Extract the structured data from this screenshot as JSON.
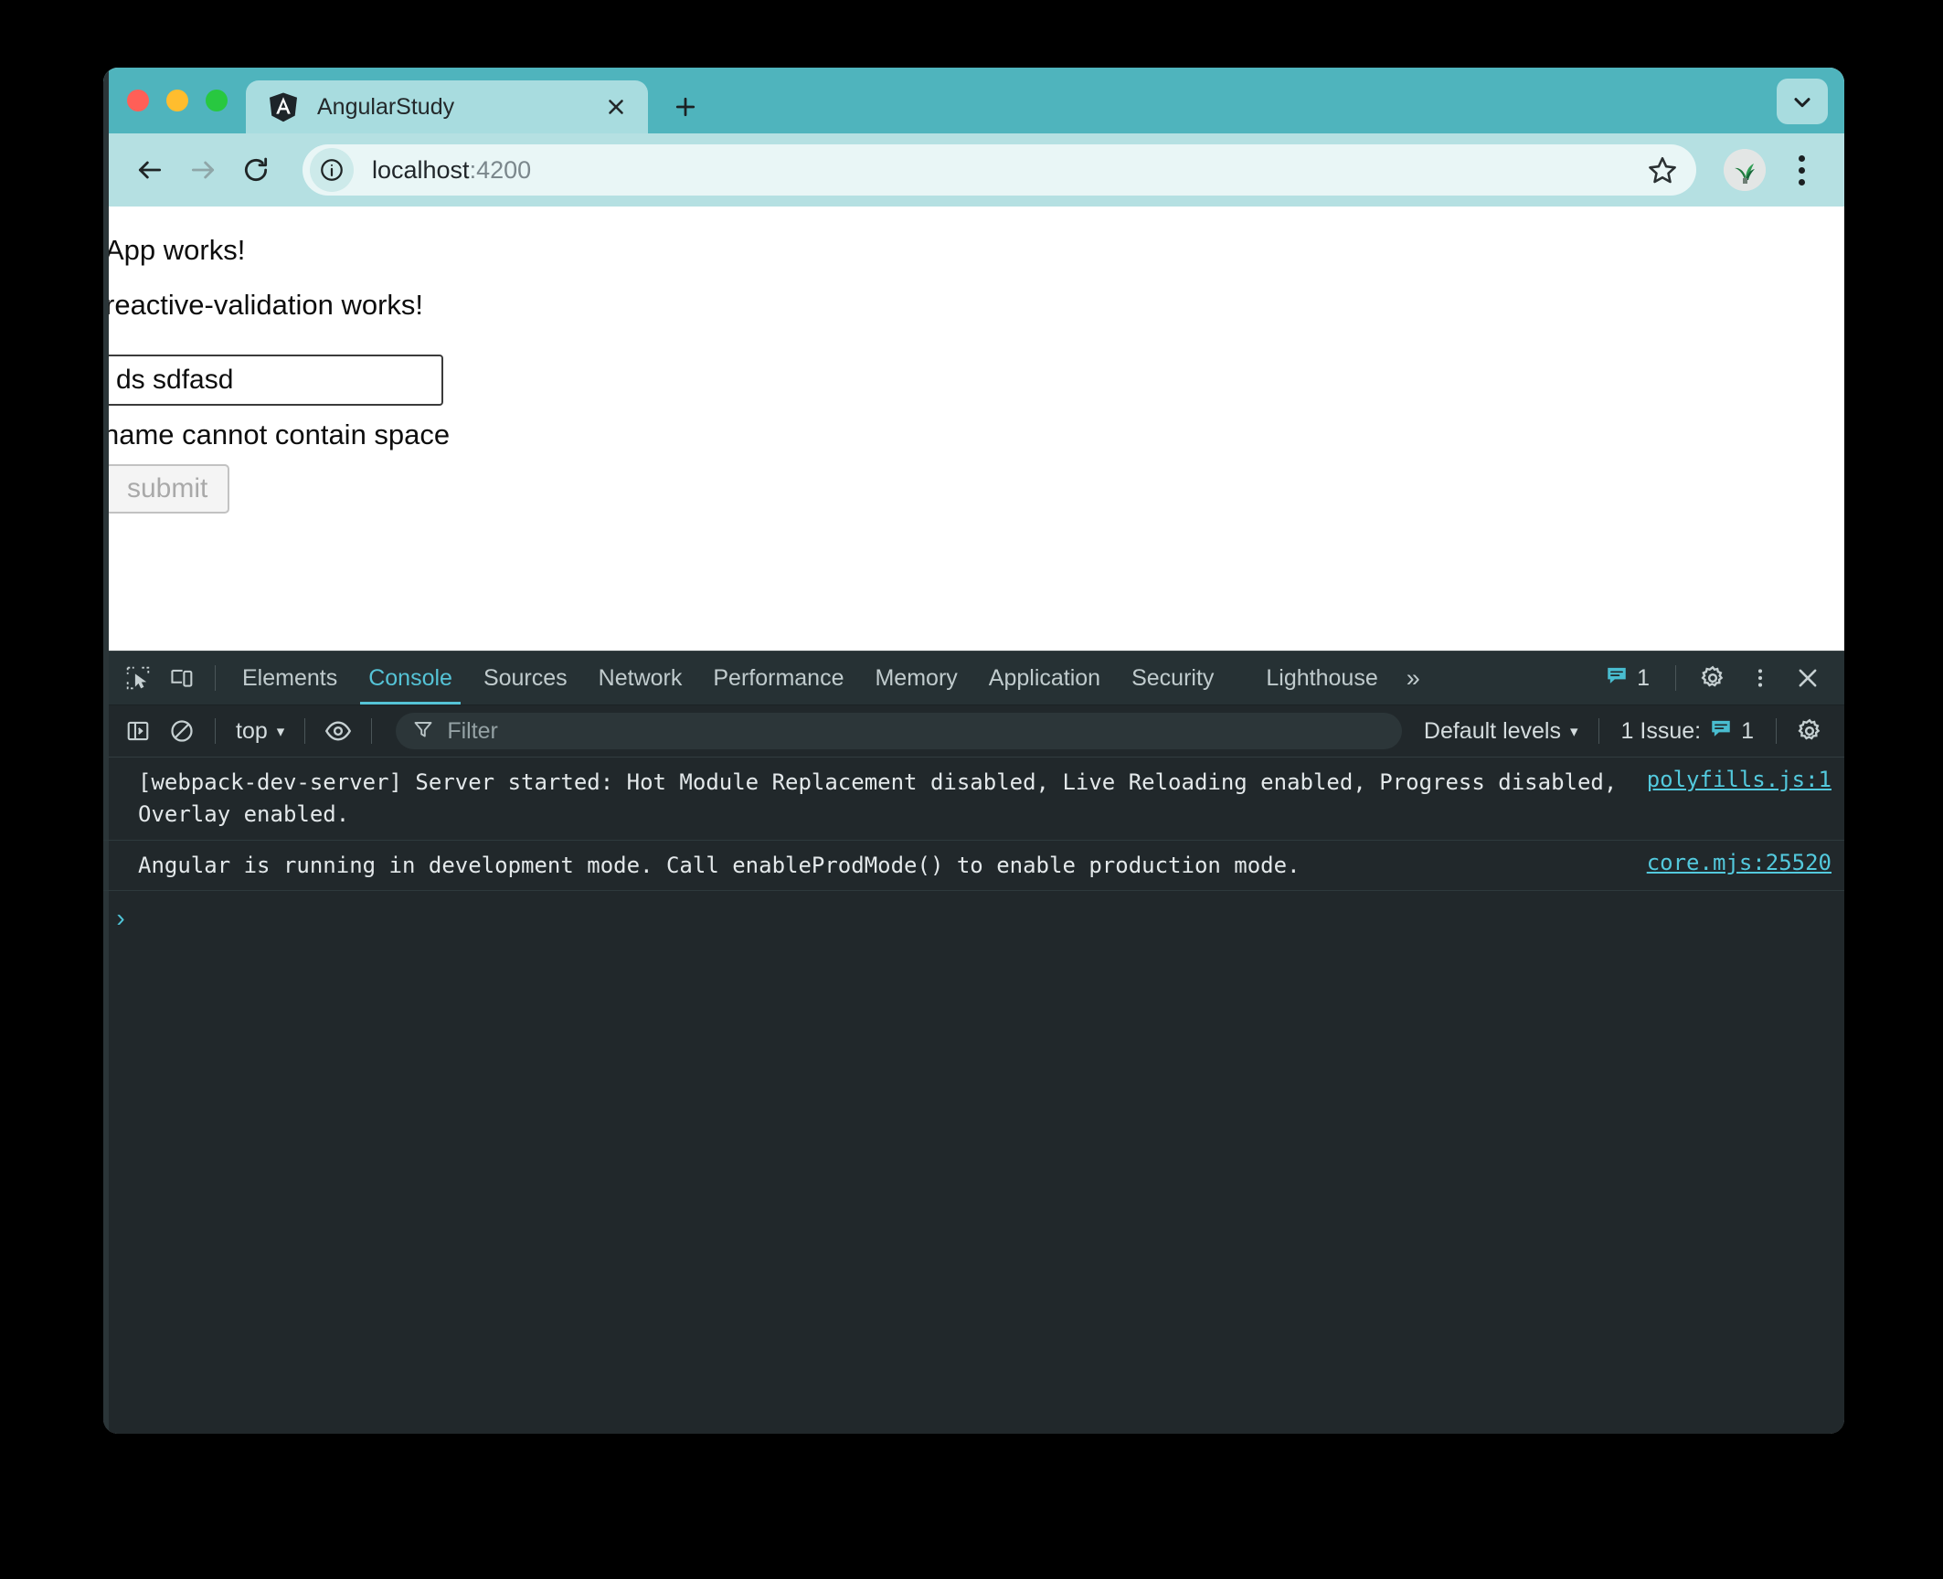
{
  "browser": {
    "window_controls": [
      "close",
      "minimize",
      "maximize"
    ],
    "tab": {
      "title": "AngularStudy",
      "favicon": "angular-logo-icon",
      "close_label": "×"
    },
    "new_tab_label": "+",
    "tab_list_chevron": "chevron-down-icon",
    "toolbar": {
      "back": "back-arrow-icon",
      "forward": "forward-arrow-icon",
      "reload": "reload-icon",
      "site_info": "info-circle-icon",
      "url_main": "localhost",
      "url_tail": ":4200",
      "bookmark": "star-icon",
      "profile": "avatar",
      "menu": "kebab-menu-icon"
    },
    "colors": {
      "tabstrip_bg": "#4fb4bd",
      "active_tab_bg": "#a8dcdf",
      "toolbar_bg": "#b5e0e2",
      "omnibox_bg": "#e9f6f6"
    }
  },
  "page": {
    "heading1": "App works!",
    "heading2": "reactive-validation works!",
    "input_value": "ds sdfasd",
    "input_placeholder": "",
    "error_message": "name cannot contain space",
    "submit_label": "submit"
  },
  "devtools": {
    "icons": {
      "inspect": "inspect-element-icon",
      "device": "device-toolbar-icon",
      "sidebar": "console-sidebar-icon",
      "clear": "clear-console-icon",
      "eye": "live-expression-eye-icon",
      "filter": "filter-funnel-icon",
      "settings": "gear-icon",
      "more": "kebab-menu-icon",
      "close": "close-icon",
      "overflow": "chevron-double-right-icon",
      "issues": "issues-message-icon"
    },
    "tabs": [
      {
        "label": "Elements",
        "active": false
      },
      {
        "label": "Console",
        "active": true
      },
      {
        "label": "Sources",
        "active": false
      },
      {
        "label": "Network",
        "active": false
      },
      {
        "label": "Performance",
        "active": false
      },
      {
        "label": "Memory",
        "active": false
      },
      {
        "label": "Application",
        "active": false
      },
      {
        "label": "Security",
        "active": false
      },
      {
        "label": "Lighthouse",
        "active": false
      }
    ],
    "overflow_label": "»",
    "issue_badge_count": "1",
    "console_toolbar": {
      "context": "top",
      "context_caret": "▾",
      "filter_placeholder": "Filter",
      "levels": "Default levels",
      "levels_caret": "▾",
      "issues_text": "1 Issue:",
      "issues_count": "1"
    },
    "console_messages": [
      {
        "text": "[webpack-dev-server] Server started: Hot Module Replacement disabled, Live Reloading enabled, Progress disabled, Overlay enabled.",
        "source": "polyfills.js:1"
      },
      {
        "text": "Angular is running in development mode. Call enableProdMode() to enable production mode.",
        "source": "core.mjs:25520"
      }
    ],
    "prompt_symbol": "›",
    "colors": {
      "bg": "#21282b",
      "tabbar_bg": "#263134",
      "accent": "#55c3d6",
      "link": "#53c9dd"
    }
  }
}
